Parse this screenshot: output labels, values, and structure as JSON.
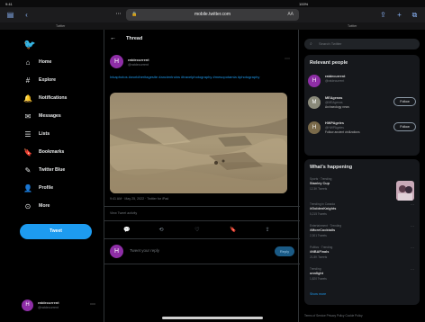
{
  "statusbar": {
    "time": "9:41",
    "date": "Wed Jun 8",
    "right": "100%"
  },
  "browser": {
    "url": "mobile.twitter.com",
    "aa": "AA",
    "tabs": [
      "Twitter",
      "Twitter"
    ]
  },
  "nav": {
    "items": [
      {
        "label": "Home",
        "icon": "home-icon",
        "glyph": "⌂"
      },
      {
        "label": "Explore",
        "icon": "hashtag-icon",
        "glyph": "#"
      },
      {
        "label": "Notifications",
        "icon": "bell-icon",
        "glyph": "♪"
      },
      {
        "label": "Messages",
        "icon": "envelope-icon",
        "glyph": "✉"
      },
      {
        "label": "Lists",
        "icon": "list-icon",
        "glyph": "☰"
      },
      {
        "label": "Bookmarks",
        "icon": "bookmark-icon",
        "glyph": "❏"
      },
      {
        "label": "Twitter Blue",
        "icon": "blue-icon",
        "glyph": "✎"
      },
      {
        "label": "Profile",
        "icon": "person-icon",
        "glyph": "☺"
      },
      {
        "label": "More",
        "icon": "more-circle-icon",
        "glyph": "⊙"
      }
    ],
    "tweet_button": "Tweet",
    "account_name": "ratdecurrent",
    "account_handle": "@ratdecurrent"
  },
  "thread": {
    "title": "Thread",
    "author_name": "ratdecurrent",
    "author_handle": "@ratdecurrent",
    "text": "Inkaphotos #worldheritagesite #ancientruins #travelphotography #mesopotamia #photography",
    "meta": "9:41 AM · May 25, 2022 · Twitter for iPad",
    "activity": "View Tweet activity",
    "reply_placeholder": "Tweet your reply",
    "reply_button": "Reply"
  },
  "right": {
    "search_placeholder": "Search Twitter",
    "relevant_title": "Relevant people",
    "people": [
      {
        "name": "ratdecurrent",
        "handle": "@ratdecurrent",
        "bio": "",
        "follow": "Follow",
        "color": "#8e2ea6",
        "initial": "H"
      },
      {
        "name": "MEAgenas",
        "handle": "@MEAgenas",
        "bio": "Archaeology news",
        "follow": "Follow",
        "color": "#8a8a7a",
        "initial": "M"
      },
      {
        "name": "HWPAgeles",
        "handle": "@HWPAgeles",
        "bio": "Follow ancient civilizations",
        "follow": "Follow",
        "color": "#7a6a4a",
        "initial": "H"
      }
    ],
    "happening_title": "What's happening",
    "trends": [
      {
        "cat": "Sports · Trending",
        "title": "Stanley Cup",
        "count": "12.3K Tweets"
      },
      {
        "cat": "Trending in Canada",
        "title": "#GoldenKnights",
        "count": "5,215 Tweets"
      },
      {
        "cat": "Entertainment · Trending",
        "title": "#MoreCocktails",
        "count": "2,301 Tweets"
      },
      {
        "cat": "Politics · Trending",
        "title": "#NBAFinals",
        "count": "21.8K Tweets"
      },
      {
        "cat": "Trending",
        "title": "onnlight",
        "count": "1,820 Tweets"
      }
    ],
    "show_more": "Show more",
    "footer": "Terms of Service   Privacy Policy   Cookie Policy"
  }
}
